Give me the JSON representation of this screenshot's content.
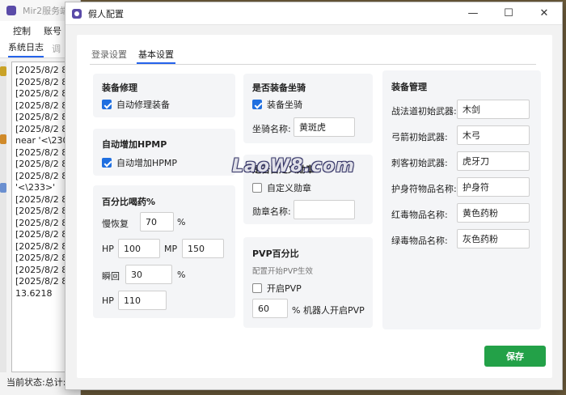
{
  "background_app": {
    "title": "Mir2服务端",
    "menu": [
      "控制",
      "账号"
    ],
    "tabs": [
      "系统日志",
      "调"
    ],
    "log_lines": [
      "[2025/8/2 8:",
      "[2025/8/2 8:",
      "[2025/8/2 8:",
      "[2025/8/2 8:",
      "[2025/8/2 8:",
      "[2025/8/2 8:",
      "near '<\\230",
      "[2025/8/2 8:",
      "[2025/8/2 8:",
      "[2025/8/2 8:",
      "'<\\233>'",
      "[2025/8/2 8:",
      "[2025/8/2 8:",
      "[2025/8/2 8:",
      "[2025/8/2 8:",
      "[2025/8/2 8:",
      "[2025/8/2 8:",
      "[2025/8/2 8:",
      "[2025/8/2 8:",
      "13.6218"
    ],
    "status": "当前状态:总计:"
  },
  "dialog": {
    "title": "假人配置",
    "window_buttons": {
      "minimize": "—",
      "maximize": "☐",
      "close": "✕"
    },
    "tabs": [
      {
        "label": "登录设置",
        "active": false
      },
      {
        "label": "基本设置",
        "active": true
      }
    ],
    "repair": {
      "title": "装备修理",
      "auto_repair": {
        "label": "自动修理装备",
        "checked": true
      }
    },
    "hpmp": {
      "title": "自动增加HPMP",
      "auto_add": {
        "label": "自动增加HPMP",
        "checked": true
      }
    },
    "potion": {
      "title": "百分比喝药%",
      "slow_label": "慢恢复",
      "slow_value": "70",
      "percent_sign": "%",
      "hp_label": "HP",
      "hp_value": "100",
      "mp_label": "MP",
      "mp_value": "150",
      "instant_label": "瞬回",
      "instant_value": "30",
      "instant_percent": "%",
      "hp2_label": "HP",
      "hp2_value": "110"
    },
    "mount": {
      "title": "是否装备坐骑",
      "equip": {
        "label": "装备坐骑",
        "checked": true
      },
      "name_label": "坐骑名称:",
      "name_value": "黄斑虎"
    },
    "medal": {
      "title": "是否自定义勋章",
      "custom": {
        "label": "自定义勋章",
        "checked": false
      },
      "name_label": "勋章名称:",
      "name_value": ""
    },
    "pvp": {
      "title": "PVP百分比",
      "subtitle": "配置开始PVP生效",
      "enable": {
        "label": "开启PVP",
        "checked": false
      },
      "value": "60",
      "suffix": "% 机器人开启PVP"
    },
    "equipment": {
      "title": "装备管理",
      "rows": [
        {
          "label": "战法道初始武器:",
          "value": "木剑"
        },
        {
          "label": "弓箭初始武器:",
          "value": "木弓"
        },
        {
          "label": "刺客初始武器:",
          "value": "虎牙刀"
        },
        {
          "label": "护身符物品名称:",
          "value": "护身符"
        },
        {
          "label": "红毒物品名称:",
          "value": "黄色药粉"
        },
        {
          "label": "绿毒物品名称:",
          "value": "灰色药粉"
        }
      ]
    },
    "save_label": "保存",
    "watermark": "LaoW8.com"
  }
}
